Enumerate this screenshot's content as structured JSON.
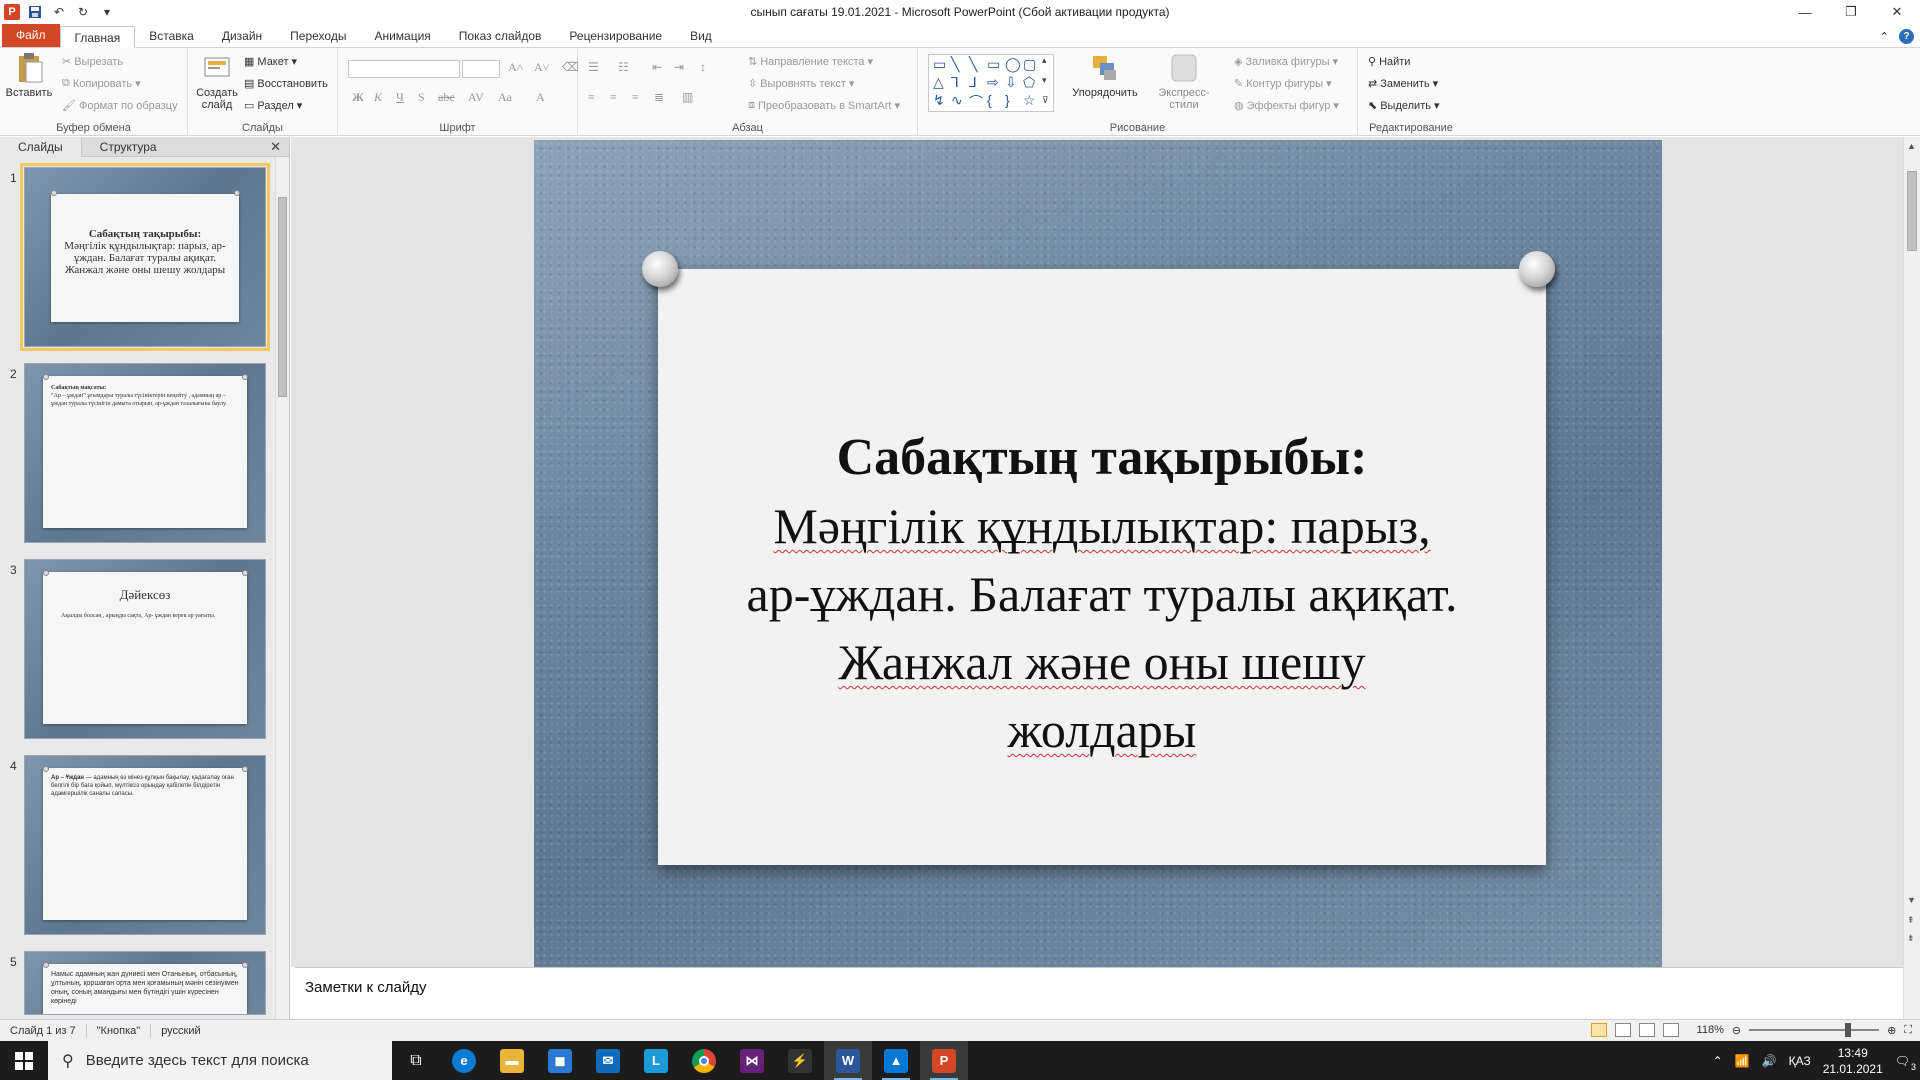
{
  "window": {
    "title": "сынып сағаты 19.01.2021  -  Microsoft PowerPoint (Сбой активации продукта)"
  },
  "tabs": [
    "Файл",
    "Главная",
    "Вставка",
    "Дизайн",
    "Переходы",
    "Анимация",
    "Показ слайдов",
    "Рецензирование",
    "Вид"
  ],
  "ribbon": {
    "clipboard": {
      "paste": "Вставить",
      "cut": "Вырезать",
      "copy": "Копировать",
      "format_painter": "Формат по образцу",
      "label": "Буфер обмена"
    },
    "slides": {
      "new_slide": "Создать слайд",
      "layout": "Макет",
      "reset": "Восстановить",
      "section": "Раздел",
      "label": "Слайды"
    },
    "font": {
      "label": "Шрифт"
    },
    "paragraph": {
      "text_direction": "Направление текста",
      "align_text": "Выровнять текст",
      "smartart": "Преобразовать в SmartArt",
      "label": "Абзац"
    },
    "drawing": {
      "arrange": "Упорядочить",
      "quick_styles": "Экспресс-стили",
      "fill": "Заливка фигуры",
      "outline": "Контур фигуры",
      "effects": "Эффекты фигур",
      "label": "Рисование"
    },
    "editing": {
      "find": "Найти",
      "replace": "Заменить",
      "select": "Выделить",
      "label": "Редактирование"
    }
  },
  "panel": {
    "tab_slides": "Слайды",
    "tab_outline": "Структура"
  },
  "thumbnails": [
    {
      "num": "1",
      "title": "Сабақтың тақырыбы:",
      "body": "Мәңгілік құндылықтар: парыз, ар-ұждан. Балағат туралы ақиқат. Жанжал және оны шешу жолдары"
    },
    {
      "num": "2",
      "title": "Сабақтың мақсаты:",
      "body": "“Ар – ұждан” ұғымдары туралы түсініктерін кеңейту , адамның ар – ұждан туралы түсінігін дамыта отырып, ар-ұждан тазалығына баулу."
    },
    {
      "num": "3",
      "title": "Дәйексөз",
      "body": "Ақылды болсаң , арыңды сақта, Ар- ұждан керек ар уағыты."
    },
    {
      "num": "4",
      "title": "Ар – Ұждан",
      "body": "— адамның өз мінез-құлқын бақылау, қадағалау оған белгілі бір баға қойып, мүлтіксіз орындау қабілетін білдіретін адамгершілік саналы сапасы."
    },
    {
      "num": "5",
      "title": "",
      "body": "Намыс адамның жан дүниесі мен Отанының, отбасының, ұлтының, қоршаған орта мен қоғамының мәнін сезінуімен оның, соның амандығы мен бүтіндігі үшін күресінен көрінеді"
    }
  ],
  "slide": {
    "title": "Сабақтың тақырыбы:",
    "lines": [
      "Мәңгілік құндылықтар: парыз,",
      "ар-ұждан. Балағат туралы ақиқат.",
      "Жанжал және оны шешу",
      "жолдары"
    ]
  },
  "notes": {
    "placeholder": "Заметки к слайду"
  },
  "status": {
    "slide_info": "Слайд 1 из 7",
    "theme": "\"Кнопка\"",
    "language": "русский",
    "zoom": "118%"
  },
  "taskbar": {
    "search_placeholder": "Введите здесь текст для поиска",
    "lang": "ҚАЗ",
    "time": "13:49",
    "date": "21.01.2021",
    "notif_count": "3"
  }
}
